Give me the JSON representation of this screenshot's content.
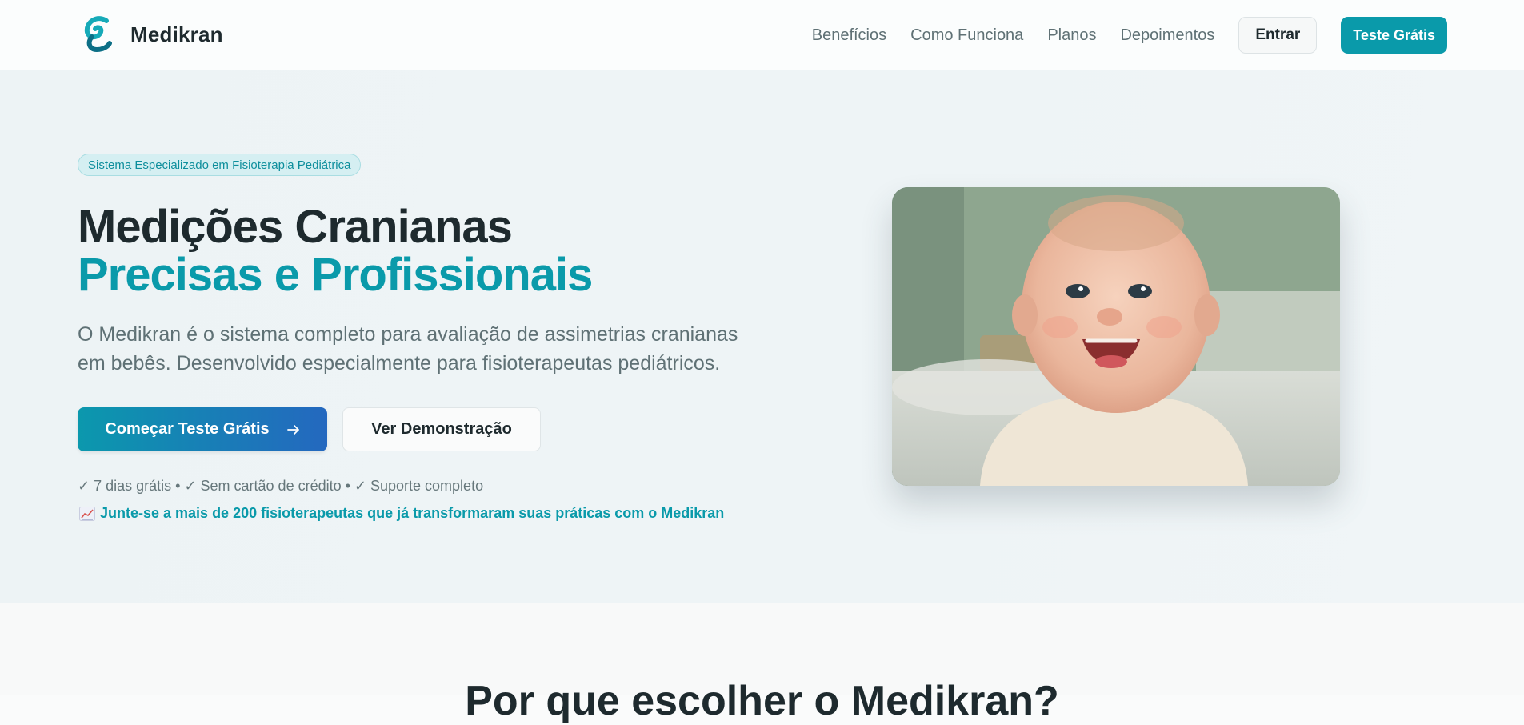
{
  "header": {
    "brand": "Medikran",
    "nav": [
      "Benefícios",
      "Como Funciona",
      "Planos",
      "Depoimentos"
    ],
    "login_label": "Entrar",
    "trial_label": "Teste Grátis"
  },
  "hero": {
    "badge": "Sistema Especializado em Fisioterapia Pediátrica",
    "title_line1": "Medições Cranianas",
    "title_line2": "Precisas e Profissionais",
    "description": "O Medikran é o sistema completo para avaliação de assimetrias cranianas em bebês. Desenvolvido especialmente para fisioterapeutas pediátricos.",
    "primary_cta": "Começar Teste Grátis",
    "secondary_cta": "Ver Demonstração",
    "features": "✓ 7 dias grátis • ✓ Sem cartão de crédito • ✓ Suporte completo",
    "social_proof": "Junte-se a mais de 200 fisioterapeutas que já transformaram suas práticas com o Medikran"
  },
  "section2": {
    "title": "Por que escolher o Medikran?"
  },
  "colors": {
    "accent": "#0a9aaa",
    "gradient_end": "#2468bf",
    "hero_background": "#edf3f5",
    "text_dark": "#1e2a2e",
    "text_muted": "#5f7175"
  },
  "icons": [
    "medikran-logo-icon",
    "arrow-right-icon",
    "chart-increasing-icon",
    "baby-photo"
  ]
}
